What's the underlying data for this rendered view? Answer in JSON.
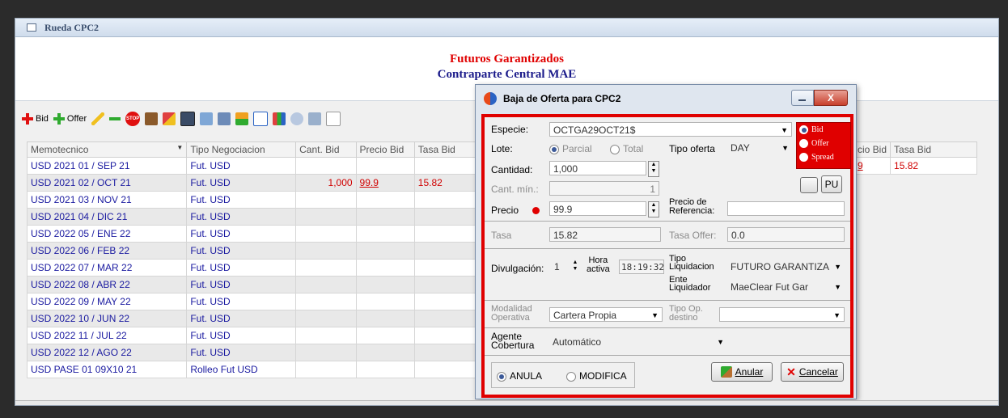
{
  "window": {
    "title": "Rueda CPC2"
  },
  "header": {
    "line1": "Futuros Garantizados",
    "line2": "Contraparte Central MAE"
  },
  "toolbar": {
    "bid_label": "Bid",
    "offer_label": "Offer",
    "stop_label": "STOP"
  },
  "grid": {
    "columns": [
      "Memotecnico",
      "Tipo Negociacion",
      "Cant. Bid",
      "Precio Bid",
      "Tasa Bid"
    ],
    "rows": [
      {
        "memo": "USD 2021 01 / SEP 21",
        "tipo": "Fut. USD",
        "cant": "",
        "precio": "",
        "tasa": ""
      },
      {
        "memo": "USD 2021 02 / OCT 21",
        "tipo": "Fut. USD",
        "cant": "1,000",
        "precio": "99.9",
        "tasa": "15.82"
      },
      {
        "memo": "USD 2021 03 / NOV 21",
        "tipo": "Fut. USD",
        "cant": "",
        "precio": "",
        "tasa": ""
      },
      {
        "memo": "USD 2021 04 / DIC 21",
        "tipo": "Fut. USD",
        "cant": "",
        "precio": "",
        "tasa": ""
      },
      {
        "memo": "USD 2022 05 / ENE 22",
        "tipo": "Fut. USD",
        "cant": "",
        "precio": "",
        "tasa": ""
      },
      {
        "memo": "USD 2022 06 / FEB 22",
        "tipo": "Fut. USD",
        "cant": "",
        "precio": "",
        "tasa": ""
      },
      {
        "memo": "USD 2022 07 / MAR 22",
        "tipo": "Fut. USD",
        "cant": "",
        "precio": "",
        "tasa": ""
      },
      {
        "memo": "USD 2022 08 / ABR 22",
        "tipo": "Fut. USD",
        "cant": "",
        "precio": "",
        "tasa": ""
      },
      {
        "memo": "USD 2022 09 / MAY 22",
        "tipo": "Fut. USD",
        "cant": "",
        "precio": "",
        "tasa": ""
      },
      {
        "memo": "USD 2022 10 / JUN 22",
        "tipo": "Fut. USD",
        "cant": "",
        "precio": "",
        "tasa": ""
      },
      {
        "memo": "USD 2022 11 / JUL 22",
        "tipo": "Fut. USD",
        "cant": "",
        "precio": "",
        "tasa": ""
      },
      {
        "memo": "USD 2022 12 / AGO 22",
        "tipo": "Fut. USD",
        "cant": "",
        "precio": "",
        "tasa": ""
      },
      {
        "memo": "USD PASE 01 09X10 21",
        "tipo": "Rolleo Fut USD",
        "cant": "",
        "precio": "",
        "tasa": ""
      }
    ]
  },
  "right_grid": {
    "col1": "cio Bid",
    "col2": "Tasa Bid",
    "val1": "9",
    "val2": "15.82"
  },
  "dialog": {
    "title": "Baja de Oferta para CPC2",
    "especie_label": "Especie:",
    "especie_value": "OCTGA29OCT21$",
    "lote_label": "Lote:",
    "lote_parcial": "Parcial",
    "lote_total": "Total",
    "tipo_oferta_label": "Tipo oferta",
    "tipo_oferta_value": "DAY",
    "side_bid": "Bid",
    "side_offer": "Offer",
    "side_spread": "Spread",
    "cantidad_label": "Cantidad:",
    "cantidad_value": "1,000",
    "cant_min_label": "Cant. mín.:",
    "cant_min_value": "1",
    "pu_label": "PU",
    "precio_label": "Precio",
    "precio_value": "99.9",
    "precio_ref_label1": "Precio de",
    "precio_ref_label2": "Referencia:",
    "tasa_label": "Tasa",
    "tasa_value": "15.82",
    "tasa_offer_label": "Tasa Offer:",
    "tasa_offer_value": "0.0",
    "divulgacion_label": "Divulgación:",
    "divulgacion_value": "1",
    "hora_label1": "Hora",
    "hora_label2": "activa",
    "hora_value": "18:19:32",
    "tipo_liq_label1": "Tipo",
    "tipo_liq_label2": "Liquidacion",
    "tipo_liq_value": "FUTURO GARANTIZA",
    "ente_label1": "Ente",
    "ente_label2": "Liquidador",
    "ente_value": "MaeClear Fut Gar",
    "modalidad_label1": "Modalidad",
    "modalidad_label2": "Operativa",
    "modalidad_value": "Cartera Propia",
    "tipo_op_label1": "Tipo Op.",
    "tipo_op_label2": "destino",
    "tipo_op_value": "",
    "agente_label1": "Agente",
    "agente_label2": "Cobertura",
    "agente_value": "Automático",
    "anula_label": "ANULA",
    "modifica_label": "MODIFICA",
    "anular_button": "Anular",
    "cancelar_button": "Cancelar"
  },
  "colors": {
    "accent_red": "#e00000",
    "title_blue": "#1a1a8a",
    "row_text": "#1a1aa0"
  }
}
